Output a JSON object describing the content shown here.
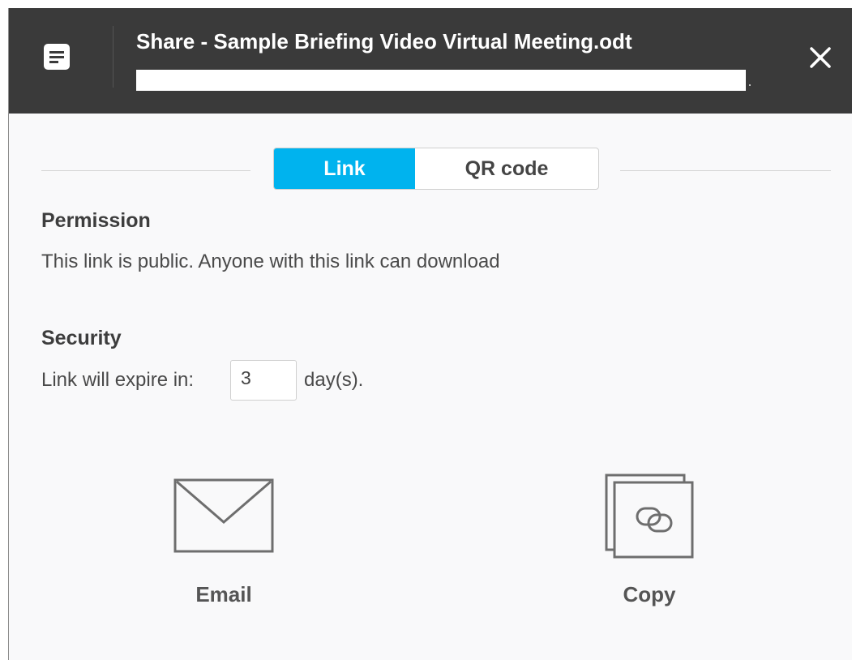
{
  "header": {
    "title": "Share - Sample Briefing Video Virtual Meeting.odt",
    "doc_icon": "document-icon",
    "close_icon": "close-icon"
  },
  "tabs": [
    {
      "label": "Link",
      "active": true
    },
    {
      "label": "QR code",
      "active": false
    }
  ],
  "permission": {
    "label": "Permission",
    "text": "This link is public. Anyone with this link can download"
  },
  "security": {
    "label": "Security",
    "prefix": "Link will expire in:",
    "days_value": "3",
    "suffix": "day(s)."
  },
  "actions": [
    {
      "label": "Email",
      "icon": "envelope-icon"
    },
    {
      "label": "Copy",
      "icon": "copy-link-icon"
    }
  ],
  "colors": {
    "header_bg": "#3a3a3a",
    "accent": "#00b3ee",
    "panel_bg": "#f9f9fa"
  }
}
